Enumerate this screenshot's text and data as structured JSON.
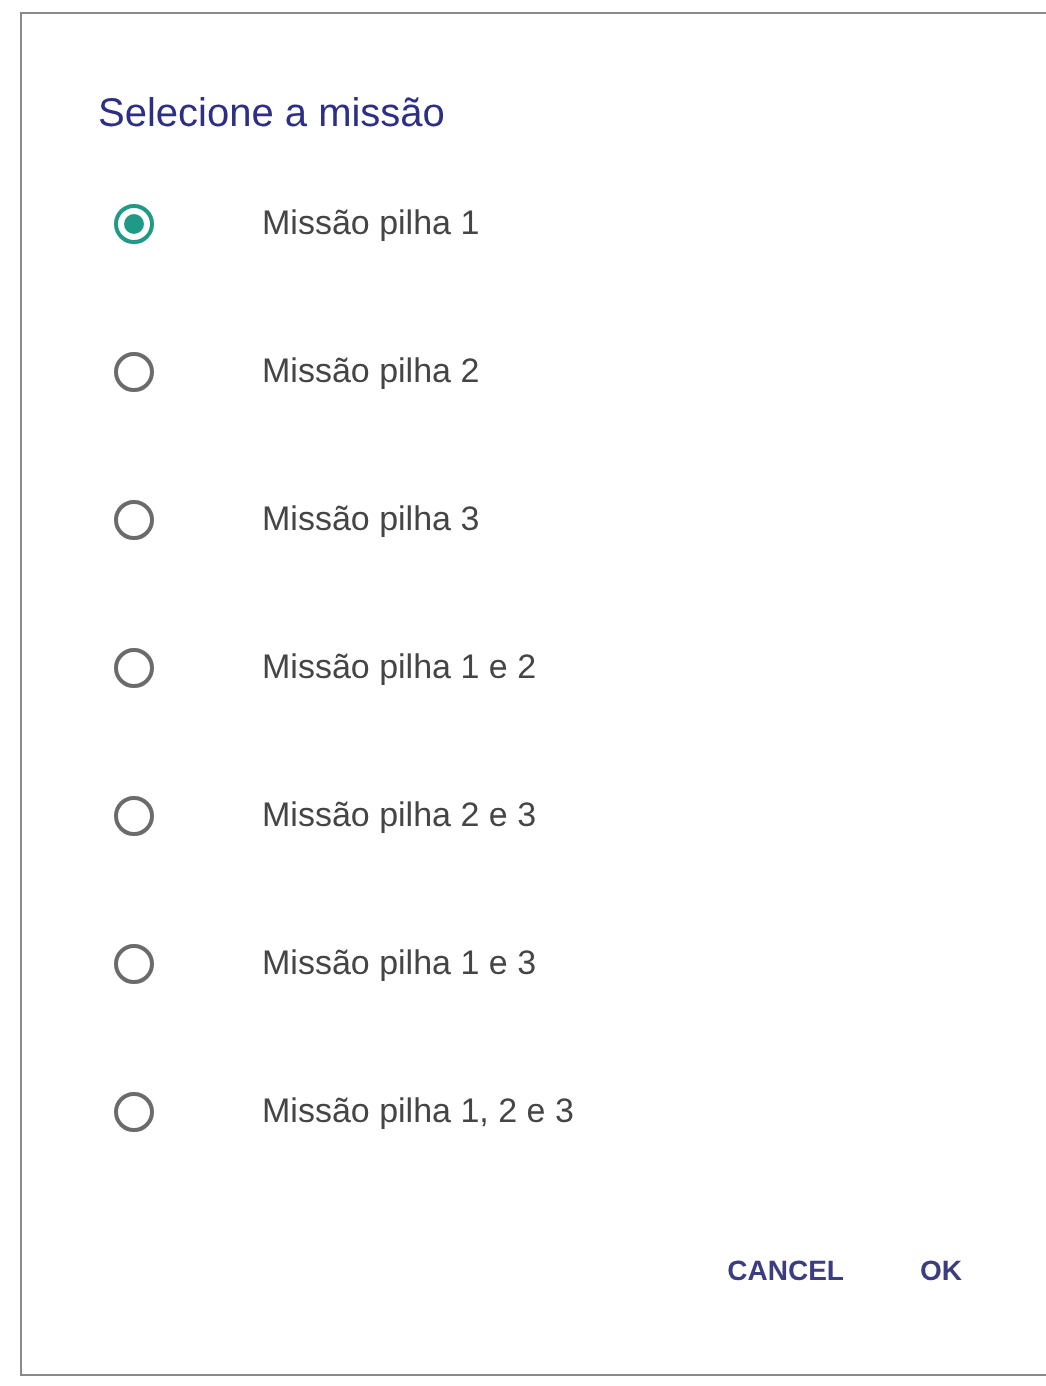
{
  "dialog": {
    "title": "Selecione a missão",
    "options": [
      {
        "label": "Missão pilha 1",
        "selected": true
      },
      {
        "label": "Missão pilha 2",
        "selected": false
      },
      {
        "label": "Missão pilha 3",
        "selected": false
      },
      {
        "label": "Missão pilha 1 e 2",
        "selected": false
      },
      {
        "label": "Missão pilha 2 e 3",
        "selected": false
      },
      {
        "label": "Missão pilha 1 e 3",
        "selected": false
      },
      {
        "label": "Missão pilha 1, 2 e 3",
        "selected": false
      }
    ],
    "buttons": [
      "CANCEL",
      "OK"
    ]
  }
}
